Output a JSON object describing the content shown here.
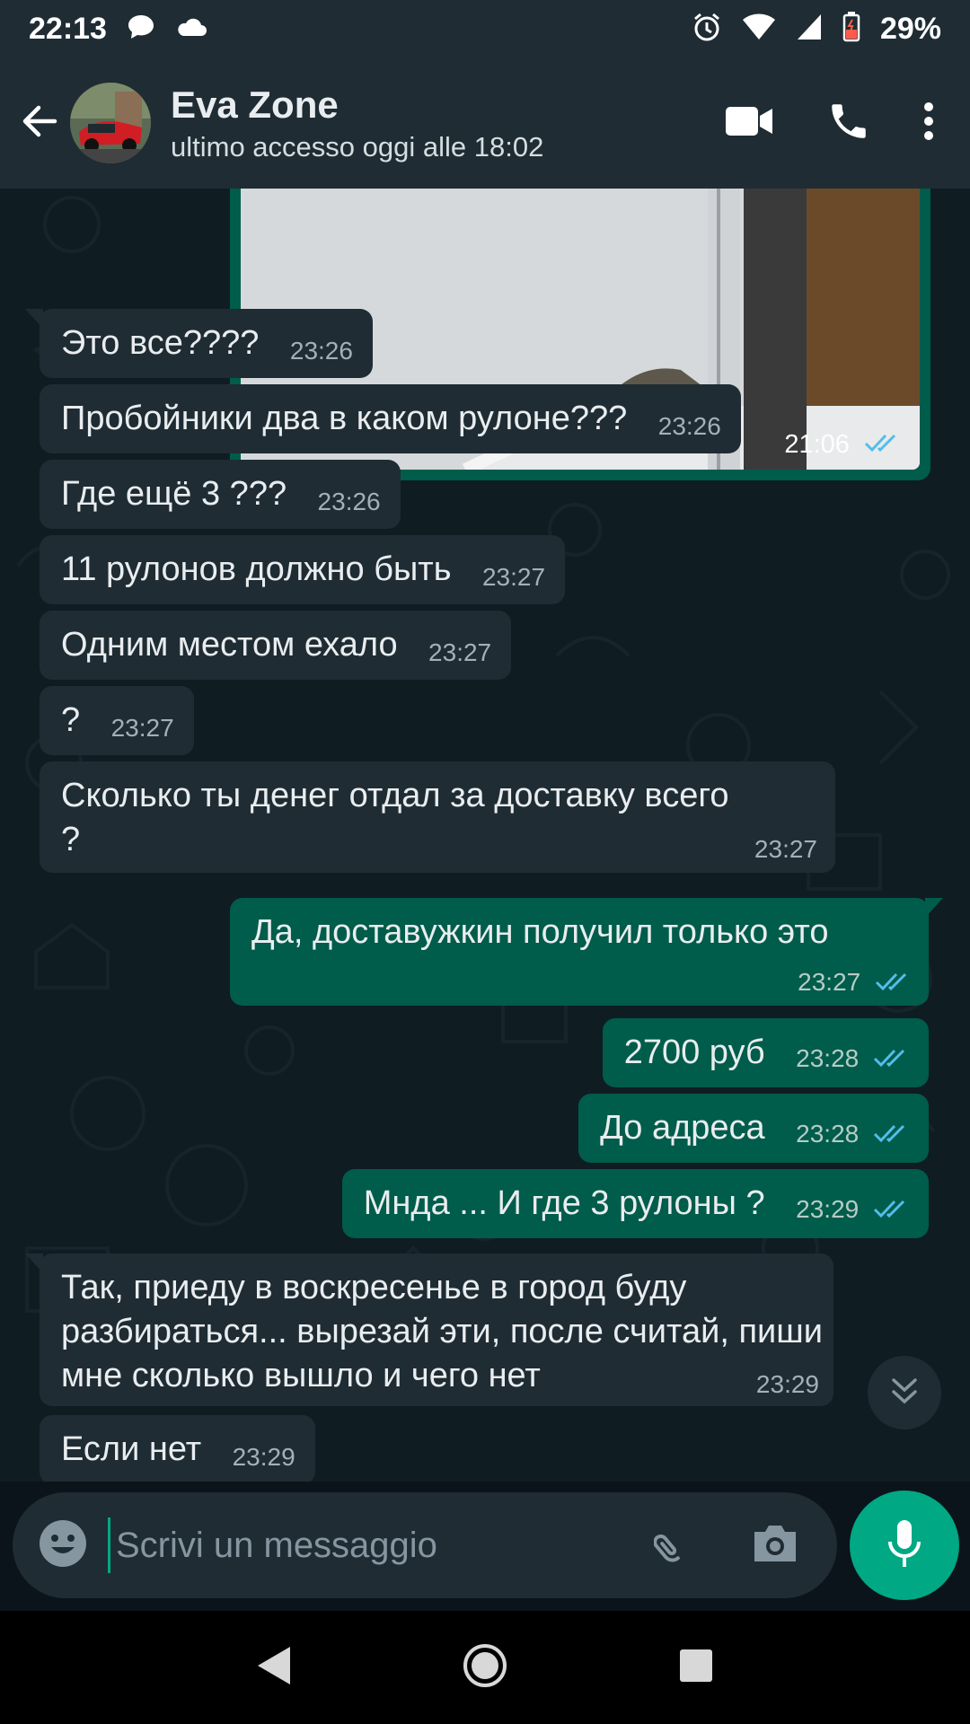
{
  "status_bar": {
    "time": "22:13",
    "battery": "29%",
    "icons": [
      "chat-bubble-icon",
      "cloud-icon",
      "alarm-icon",
      "wifi-icon",
      "signal-icon",
      "battery-icon"
    ]
  },
  "header": {
    "contact_name": "Eva Zone",
    "last_seen": "ultimo accesso oggi alle 18:02",
    "icons": [
      "back-arrow-icon",
      "video-call-icon",
      "phone-icon",
      "more-vertical-icon"
    ]
  },
  "photo_message": {
    "time": "21:06",
    "status": "read"
  },
  "messages": [
    {
      "dir": "in",
      "text": "Это все????",
      "time": "23:26"
    },
    {
      "dir": "in",
      "text": "Пробойники два в каком рулоне???",
      "time": "23:26"
    },
    {
      "dir": "in",
      "text": "Где ещё 3 ???",
      "time": "23:26"
    },
    {
      "dir": "in",
      "text": "11 рулонов должно быть",
      "time": "23:27"
    },
    {
      "dir": "in",
      "text": "Одним местом ехало",
      "time": "23:27"
    },
    {
      "dir": "in",
      "text": "?",
      "time": "23:27"
    },
    {
      "dir": "in",
      "text": "Сколько ты денег отдал за доставку всего ?",
      "time": "23:27"
    },
    {
      "dir": "out",
      "text": "Да, доставужкин получил только это",
      "time": "23:27",
      "status": "read"
    },
    {
      "dir": "out",
      "text": "2700 руб",
      "time": "23:28",
      "status": "read"
    },
    {
      "dir": "out",
      "text": "До адреса",
      "time": "23:28",
      "status": "read"
    },
    {
      "dir": "out",
      "text": "Мнда ... И где 3 рулоны ?",
      "time": "23:29",
      "status": "read"
    },
    {
      "dir": "in",
      "text": "Так, приеду в воскресенье в город буду разбираться... вырезай эти, после считай, пиши мне сколько вышло и чего нет",
      "time": "23:29"
    },
    {
      "dir": "in",
      "text": "Если нет",
      "time": "23:29"
    }
  ],
  "composer": {
    "placeholder": "Scrivi un messaggio",
    "icons": [
      "emoji-icon",
      "attach-icon",
      "camera-icon",
      "mic-icon"
    ]
  },
  "colors": {
    "header_bg": "#1f2c34",
    "chat_bg": "#0f1c22",
    "incoming_bubble": "#1f2c34",
    "outgoing_bubble": "#005c4b",
    "accent": "#00a884",
    "read_tick": "#53bdeb"
  }
}
